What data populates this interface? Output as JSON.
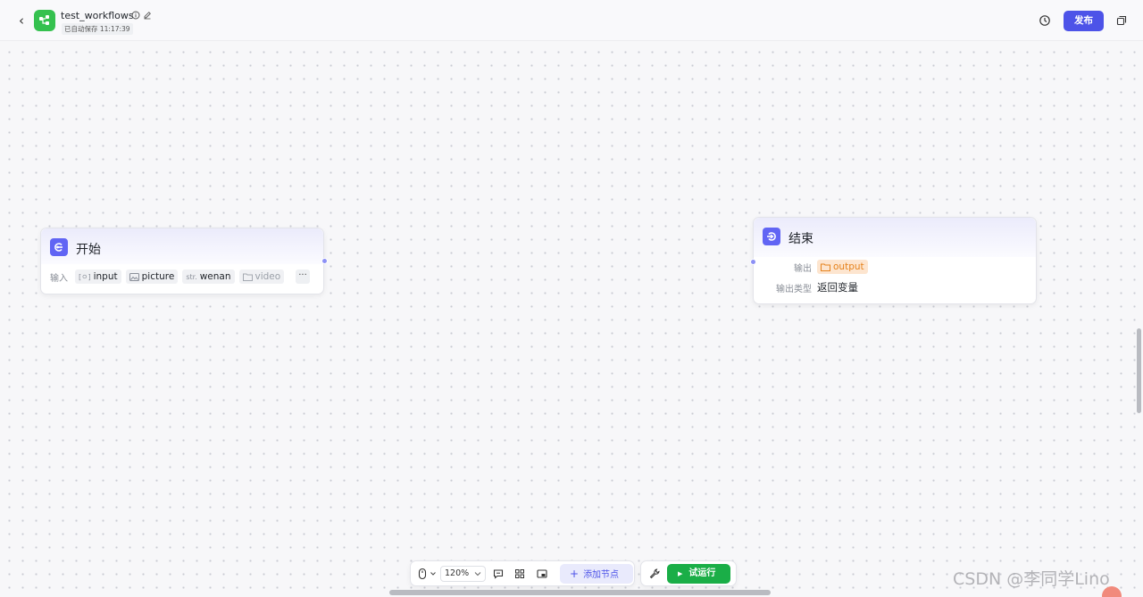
{
  "header": {
    "title": "test_workflows",
    "save_status": "已自动保存 11:17:39",
    "publish_label": "发布"
  },
  "canvas": {
    "start_node": {
      "title": "开始",
      "inputs_label": "输入",
      "inputs": [
        {
          "name": "input",
          "icon": "[ㅇ]"
        },
        {
          "name": "picture",
          "icon": "image-icon"
        },
        {
          "name": "wenan",
          "icon": "str."
        },
        {
          "name": "video",
          "icon": "folder-icon"
        }
      ],
      "more": "···"
    },
    "end_node": {
      "title": "结束",
      "output_label": "输出",
      "output_var": "output",
      "output_type_label": "输出类型",
      "output_type_value": "返回变量"
    }
  },
  "toolbar": {
    "zoom": "120%",
    "add_node": "添加节点",
    "run": "试运行"
  },
  "watermark": "CSDN @李同学Lino",
  "colors": {
    "accent": "#4d53e8",
    "node_icon": "#6165f4",
    "run": "#1aae47",
    "logo": "#35c14f",
    "output_tag": "#fde5cf"
  }
}
